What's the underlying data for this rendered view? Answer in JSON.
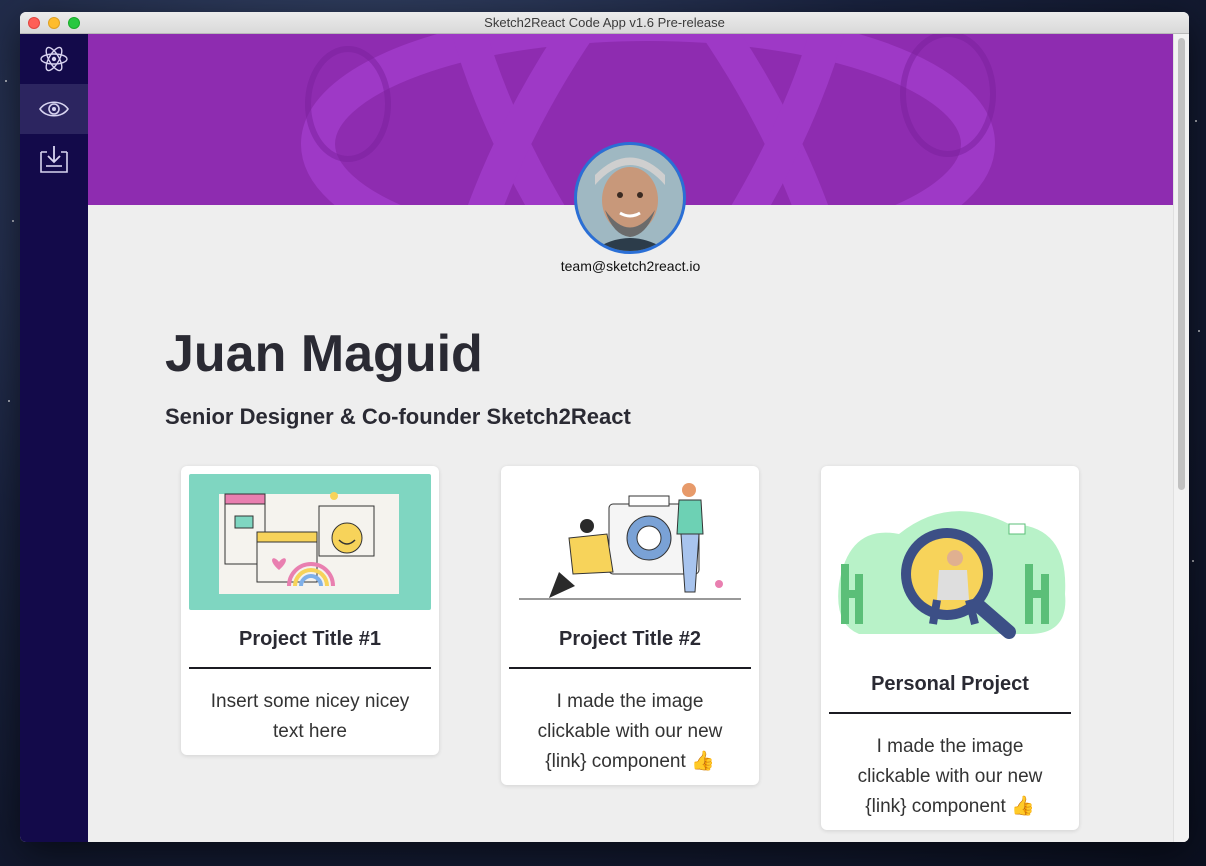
{
  "window": {
    "title": "Sketch2React Code App v1.6 Pre-release"
  },
  "sidebar": {
    "items": [
      {
        "icon": "atom-icon"
      },
      {
        "icon": "eye-icon"
      },
      {
        "icon": "export-icon"
      }
    ]
  },
  "profile": {
    "email": "team@sketch2react.io",
    "name": "Juan Maguid",
    "role": "Senior Designer & Co-founder Sketch2React"
  },
  "cards": [
    {
      "title": "Project Title #1",
      "text": "Insert some nicey nicey text here"
    },
    {
      "title": "Project Title #2",
      "text": "I made the image clickable with our new {link} component 👍"
    },
    {
      "title": "Personal Project",
      "text": "I made the image clickable with our new {link} component 👍"
    }
  ],
  "colors": {
    "sidebar": "#130a4a",
    "hero": "#8e2cb0",
    "accent": "#2a6fd6"
  }
}
